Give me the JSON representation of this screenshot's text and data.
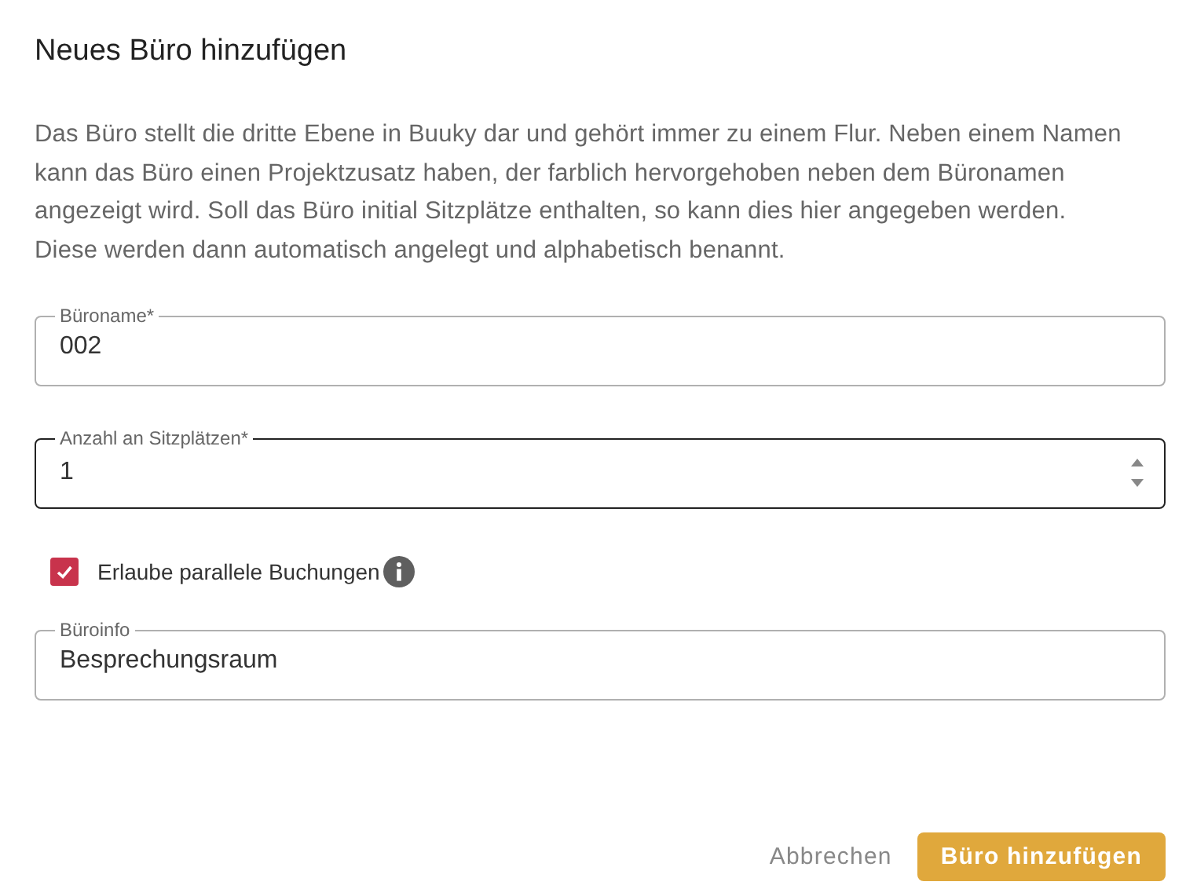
{
  "dialog": {
    "title": "Neues Büro hinzufügen",
    "description": "Das Büro stellt die dritte Ebene in Buuky dar und gehört immer zu einem Flur. Neben einem Namen kann das Büro einen Projektzusatz haben, der farblich hervorgehoben neben dem Büronamen angezeigt wird. Soll das Büro initial Sitzplätze enthalten, so kann dies hier angegeben werden. Diese werden dann automatisch angelegt und alphabetisch benannt."
  },
  "fields": [
    {
      "kind": "text",
      "label": "Büroname*",
      "value": "002",
      "focused": false
    },
    {
      "kind": "number",
      "label": "Anzahl an Sitzplätzen*",
      "value": "1",
      "focused": true
    }
  ],
  "checkbox": {
    "label": "Erlaube parallele Buchungen",
    "checked": true
  },
  "info_field": {
    "label": "Büroinfo",
    "value": "Besprechungsraum",
    "focused": false
  },
  "buttons": [
    {
      "kind": "text",
      "label": "Abbrechen"
    },
    {
      "kind": "primary",
      "label": "Büro hinzufügen"
    }
  ]
}
